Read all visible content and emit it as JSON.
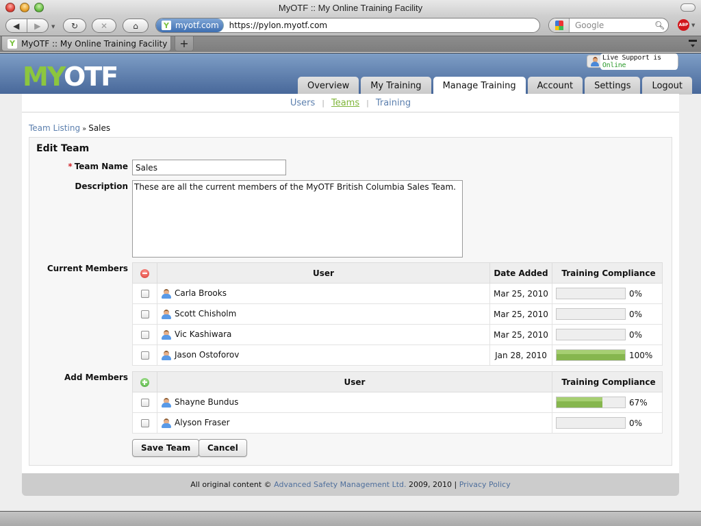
{
  "browser": {
    "window_title": "MyOTF :: My Online Training Facility",
    "site_identity": "myotf.com",
    "url": "https://pylon.myotf.com",
    "search_placeholder": "Google",
    "tab_title": "MyOTF :: My Online Training Facility",
    "new_tab_label": "+",
    "abp_label": "ABP"
  },
  "header": {
    "logo_my": "MY",
    "logo_otf": "OTF",
    "live_support_prefix": "Live Support is ",
    "live_support_status": "Online",
    "tabs": [
      {
        "label": "Overview"
      },
      {
        "label": "My Training"
      },
      {
        "label": "Manage Training",
        "active": true
      },
      {
        "label": "Account"
      },
      {
        "label": "Settings"
      },
      {
        "label": "Logout"
      }
    ]
  },
  "subnav": {
    "items": [
      {
        "label": "Users"
      },
      {
        "label": "Teams",
        "active": true
      },
      {
        "label": "Training"
      }
    ],
    "separator": "|"
  },
  "breadcrumb": {
    "parent": "Team Listing",
    "separator": "»",
    "current": "Sales"
  },
  "form": {
    "title": "Edit Team",
    "required_marker": "*",
    "team_name_label": "Team Name",
    "team_name_value": "Sales",
    "description_label": "Description",
    "description_value": "These are all the current members of the MyOTF British Columbia Sales Team.",
    "current_members_label": "Current Members",
    "add_members_label": "Add Members",
    "save_label": "Save Team",
    "cancel_label": "Cancel"
  },
  "current_members": {
    "headers": {
      "user": "User",
      "date_added": "Date Added",
      "compliance": "Training Compliance"
    },
    "rows": [
      {
        "name": "Carla Brooks",
        "date_added": "Mar 25, 2010",
        "compliance_pct": 0,
        "compliance_label": "0%"
      },
      {
        "name": "Scott Chisholm",
        "date_added": "Mar 25, 2010",
        "compliance_pct": 0,
        "compliance_label": "0%"
      },
      {
        "name": "Vic Kashiwara",
        "date_added": "Mar 25, 2010",
        "compliance_pct": 0,
        "compliance_label": "0%"
      },
      {
        "name": "Jason Ostoforov",
        "date_added": "Jan 28, 2010",
        "compliance_pct": 100,
        "compliance_label": "100%"
      }
    ]
  },
  "add_members": {
    "headers": {
      "user": "User",
      "compliance": "Training Compliance"
    },
    "rows": [
      {
        "name": "Shayne Bundus",
        "compliance_pct": 67,
        "compliance_label": "67%"
      },
      {
        "name": "Alyson Fraser",
        "compliance_pct": 0,
        "compliance_label": "0%"
      }
    ]
  },
  "footer": {
    "prefix": "All original content © ",
    "company_link": "Advanced Safety Management Ltd.",
    "years": " 2009, 2010 | ",
    "privacy_link": "Privacy Policy"
  },
  "colors": {
    "brand_green": "#8cc63f",
    "header_blue": "#48689a",
    "link_blue": "#5b7fae",
    "progress_green": "#86b64e",
    "online_green": "#2a9a2a"
  }
}
